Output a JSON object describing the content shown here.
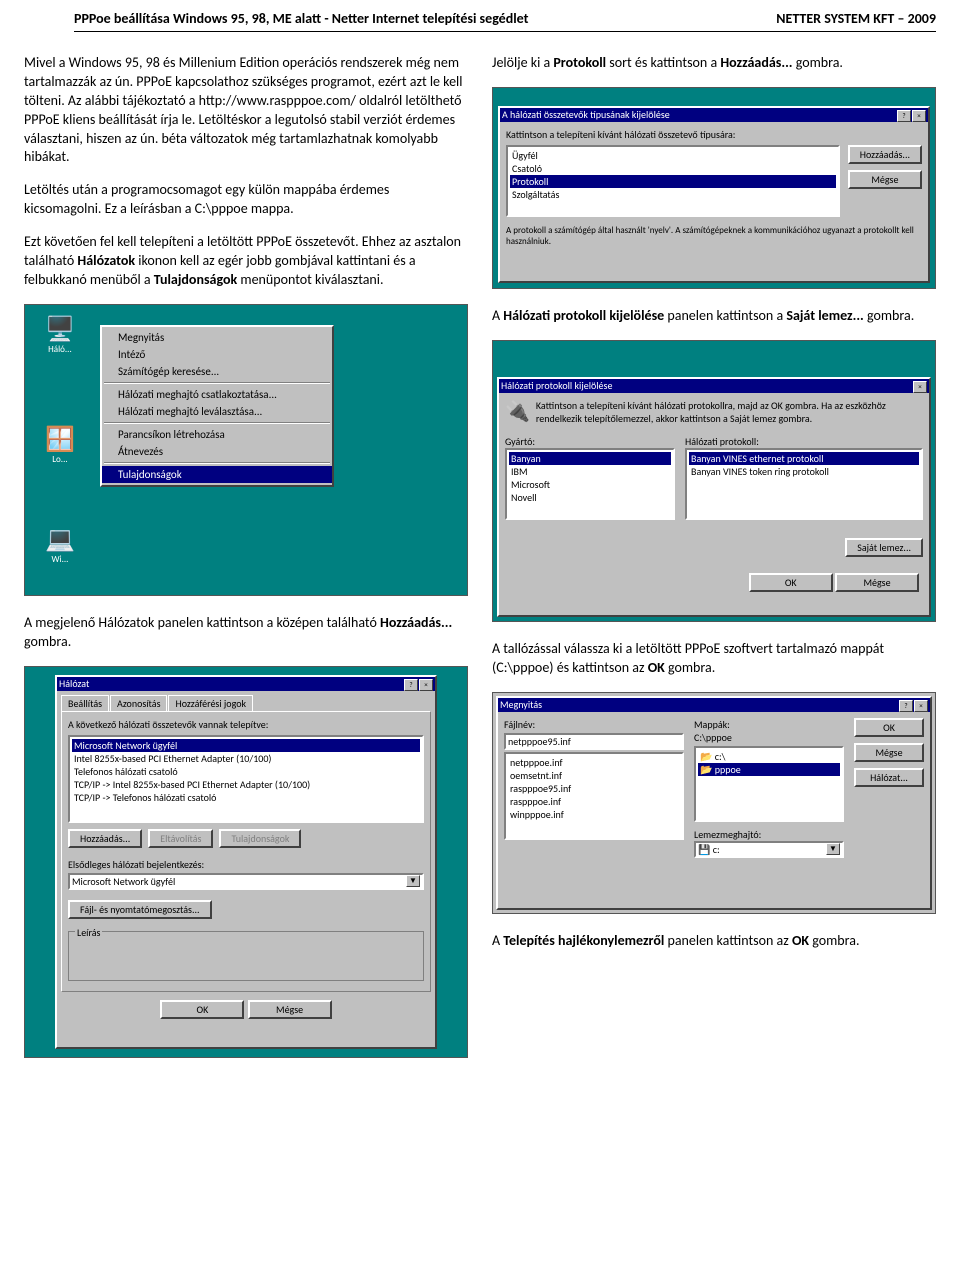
{
  "header": {
    "left": "PPPoe beállítása Windows 95, 98, ME alatt - Netter Internet telepítési segédlet",
    "right": "NETTER SYSTEM KFT – 2009"
  },
  "left_col": {
    "p1": "Mivel a Windows 95, 98 és Millenium Edition operációs rendszerek még nem tartalmazzák az ún. PPPoE kapcsolathoz szükséges programot, ezért azt le kell tölteni. Az alábbi tájékoztató a http://www.raspppoe.com/ oldalról letölthető PPPoE kliens beállítását írja le. Letöltéskor a legutolsó stabil verziót érdemes választani, hiszen az ún. béta változatok még tartamlazhatnak komolyabb hibákat.",
    "p2": "Letöltés után a programocsomagot egy külön mappába érdemes kicsomagolni. Ez a leírásban a C:\\pppoe mappa.",
    "p3_before": "Ezt követően fel kell telepíteni a letöltött PPPoE összetevőt. Ehhez az asztalon található ",
    "p3_bold1": "Hálózatok",
    "p3_mid": " ikonon kell az egér jobb gombjával kattintani és a felbukkanó menüből a ",
    "p3_bold2": "Tulajdonságok",
    "p3_after": " menüpontot kiválasztani.",
    "p4_before": "A megjelenő Hálózatok panelen kattintson a középen található ",
    "p4_bold": "Hozzáadás...",
    "p4_after": " gombra.",
    "context_menu": [
      "Megnyitás",
      "Intéző",
      "Számítógép keresése...",
      "Hálózati meghajtó csatlakoztatása...",
      "Hálózati meghajtó leválasztása...",
      "Parancsíkon létrehozása",
      "Átnevezés",
      "Tulajdonságok"
    ],
    "desktop_icons": {
      "net_label": "Háló...",
      "logo_label": "Lo...",
      "mycomp_label": "Wi..."
    },
    "net_panel": {
      "title": "Hálózat",
      "tabs": [
        "Beállítás",
        "Azonosítás",
        "Hozzáférési jogok"
      ],
      "heading": "A következő hálózati összetevők vannak telepítve:",
      "items": [
        "Microsoft Network ügyfél",
        "Intel 8255x-based PCI Ethernet Adapter (10/100)",
        "Telefonos hálózati csatoló",
        "TCP/IP -> Intel 8255x-based PCI Ethernet Adapter (10/100)",
        "TCP/IP -> Telefonos hálózati csatoló"
      ],
      "btn_add": "Hozzáadás...",
      "btn_remove": "Eltávolítás",
      "btn_props": "Tulajdonságok",
      "login_label": "Elsődleges hálózati bejelentkezés:",
      "login_value": "Microsoft Network ügyfél",
      "btn_share": "Fájl- és nyomtatómegosztás...",
      "desc_title": "Leírás",
      "ok": "OK",
      "cancel": "Mégse"
    }
  },
  "right_col": {
    "p1_before": "Jelölje ki a ",
    "p1_bold1": "Protokoll",
    "p1_mid": " sort és kattintson a ",
    "p1_bold2": "Hozzáadás...",
    "p1_after": " gombra.",
    "types_panel": {
      "title": "A hálózati összetevők típusának kijelölése",
      "heading": "Kattintson a telepíteni kívánt hálózati összetevő típusára:",
      "items": [
        "Ügyfél",
        "Csatoló",
        "Protokoll",
        "Szolgáltatás"
      ],
      "btn_add": "Hozzáadás...",
      "btn_cancel": "Mégse",
      "desc": "A protokoll a számítógép által használt 'nyelv'. A számítógépeknek a kommunikációhoz ugyanazt a protokollt kell használniuk.",
      "close": "?  ×"
    },
    "p2_before": "A ",
    "p2_bold1": "Hálózati protokoll kijelölése",
    "p2_mid": " panelen kattintson a ",
    "p2_bold2": "Saját lemez...",
    "p2_after": " gombra.",
    "proto_panel": {
      "title": "Hálózati protokoll kijelölése",
      "heading": "Kattintson a telepíteni kívánt hálózati protokollra, majd az OK gombra. Ha az eszközhöz rendelkezik telepítőlemezzel, akkor kattintson a Saját lemez gombra.",
      "makers_label": "Gyártó:",
      "makers": [
        "Banyan",
        "IBM",
        "Microsoft",
        "Novell"
      ],
      "protos_label": "Hálózati protokoll:",
      "protos": [
        "Banyan VINES ethernet protokoll",
        "Banyan VINES token ring protokoll"
      ],
      "btn_disk": "Saját lemez...",
      "ok": "OK",
      "cancel": "Mégse"
    },
    "p3_before": "A tallózással válassza ki a letöltött PPPoE szoftvert tartalmazó mappát (C:\\pppoe) és kattintson az ",
    "p3_bold": "OK",
    "p3_after": " gombra.",
    "open_panel": {
      "title": "Megnyitás",
      "file_label": "Fájlnév:",
      "file_value": "netpppoe95.inf",
      "files": [
        "netpppoe.inf",
        "oemsetnt.inf",
        "raspppoe95.inf",
        "raspppoe.inf",
        "winpppoe.inf"
      ],
      "dir_label": "Mappák:",
      "dir_value": "C:\\pppoe",
      "dirs": [
        "c:\\",
        "pppoe"
      ],
      "drive_label": "Lemezmeghajtó:",
      "drive_value": "c:",
      "ok": "OK",
      "cancel": "Mégse",
      "net": "Hálózat..."
    },
    "p4_before": "A ",
    "p4_bold": "Telepítés hajlékonylemezről",
    "p4_mid": " panelen kattintson az ",
    "p4_bold2": "OK",
    "p4_after": " gombra."
  }
}
